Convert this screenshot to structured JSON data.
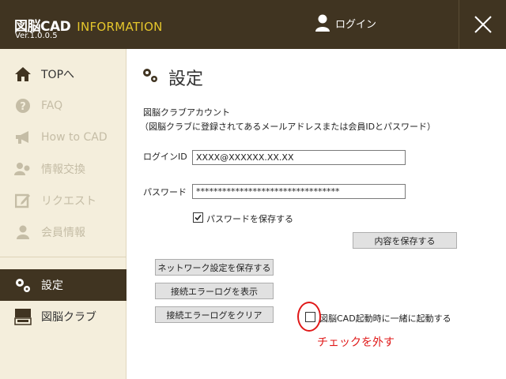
{
  "header": {
    "brand_name": "図脳CAD",
    "brand_info": "INFORMATION",
    "version": "Ver.1.0.0.5",
    "login_label": "ログイン"
  },
  "sidebar": {
    "items": [
      {
        "label": "TOPへ",
        "icon": "home-icon"
      },
      {
        "label": "FAQ",
        "icon": "question-icon"
      },
      {
        "label": "How to CAD",
        "icon": "megaphone-icon"
      },
      {
        "label": "情報交換",
        "icon": "people-icon"
      },
      {
        "label": "リクエスト",
        "icon": "edit-icon"
      },
      {
        "label": "会員情報",
        "icon": "user-icon"
      },
      {
        "label": "設定",
        "icon": "gears-icon"
      },
      {
        "label": "図脳クラブ",
        "icon": "club-logo-icon"
      }
    ]
  },
  "main": {
    "title": "設定",
    "account_heading": "図脳クラブアカウント",
    "account_note": "（図脳クラブに登録されてあるメールアドレスまたは会員IDとパスワード）",
    "login_id_label": "ログインID",
    "login_id_value": "XXXX@XXXXXX.XX.XX",
    "password_label": "パスワード",
    "password_value": "*********************************",
    "save_password_label": "パスワードを保存する",
    "save_password_checked": true,
    "save_content_button": "内容を保存する",
    "network_save_button": "ネットワーク設定を保存する",
    "show_error_log_button": "接続エラーログを表示",
    "clear_error_log_button": "接続エラーログをクリア",
    "startup_label": "図脳CAD起動時に一緒に起動する",
    "startup_checked": false,
    "annotation": "チェックを外す"
  },
  "colors": {
    "header_bg": "#403421",
    "accent_yellow": "#e5c62c",
    "sidebar_bg": "#f4eedc",
    "annotation_red": "#e01818"
  }
}
